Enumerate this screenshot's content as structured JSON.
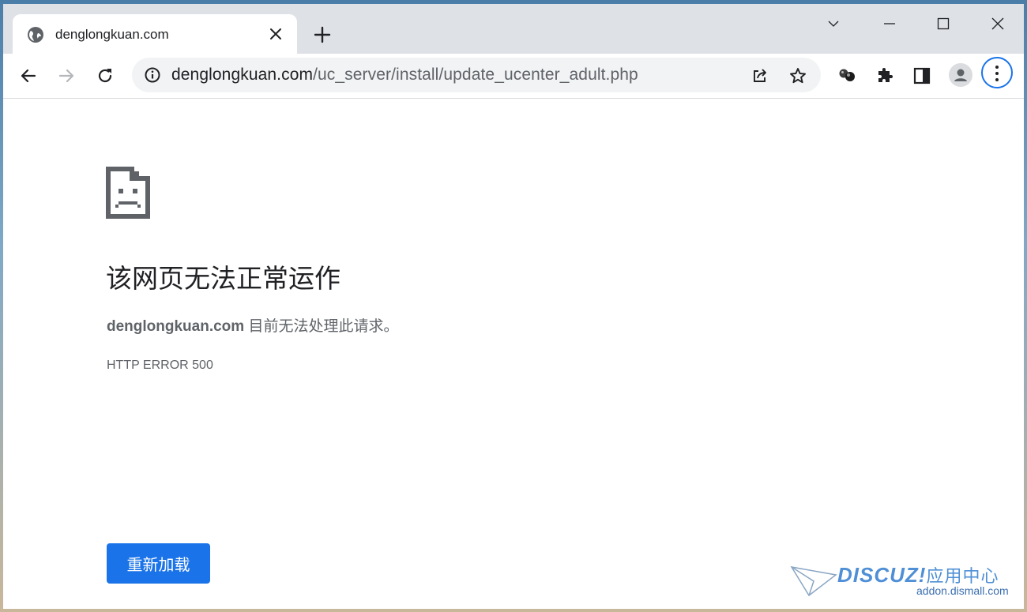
{
  "tab": {
    "title": "denglongkuan.com",
    "favicon": "globe-icon"
  },
  "toolbar": {
    "url_host": "denglongkuan.com",
    "url_path": "/uc_server/install/update_ucenter_adult.php"
  },
  "error_page": {
    "heading": "该网页无法正常运作",
    "description_host": "denglongkuan.com",
    "description_text": " 目前无法处理此请求。",
    "error_code": "HTTP ERROR 500",
    "reload_label": "重新加载"
  },
  "watermark": {
    "brand": "DISCUZ!",
    "brand_cn": "应用中心",
    "site": "addon.dismall.com"
  },
  "colors": {
    "accent": "#1a73e8",
    "tabstrip": "#dee1e6",
    "omnibox": "#f1f3f4"
  }
}
